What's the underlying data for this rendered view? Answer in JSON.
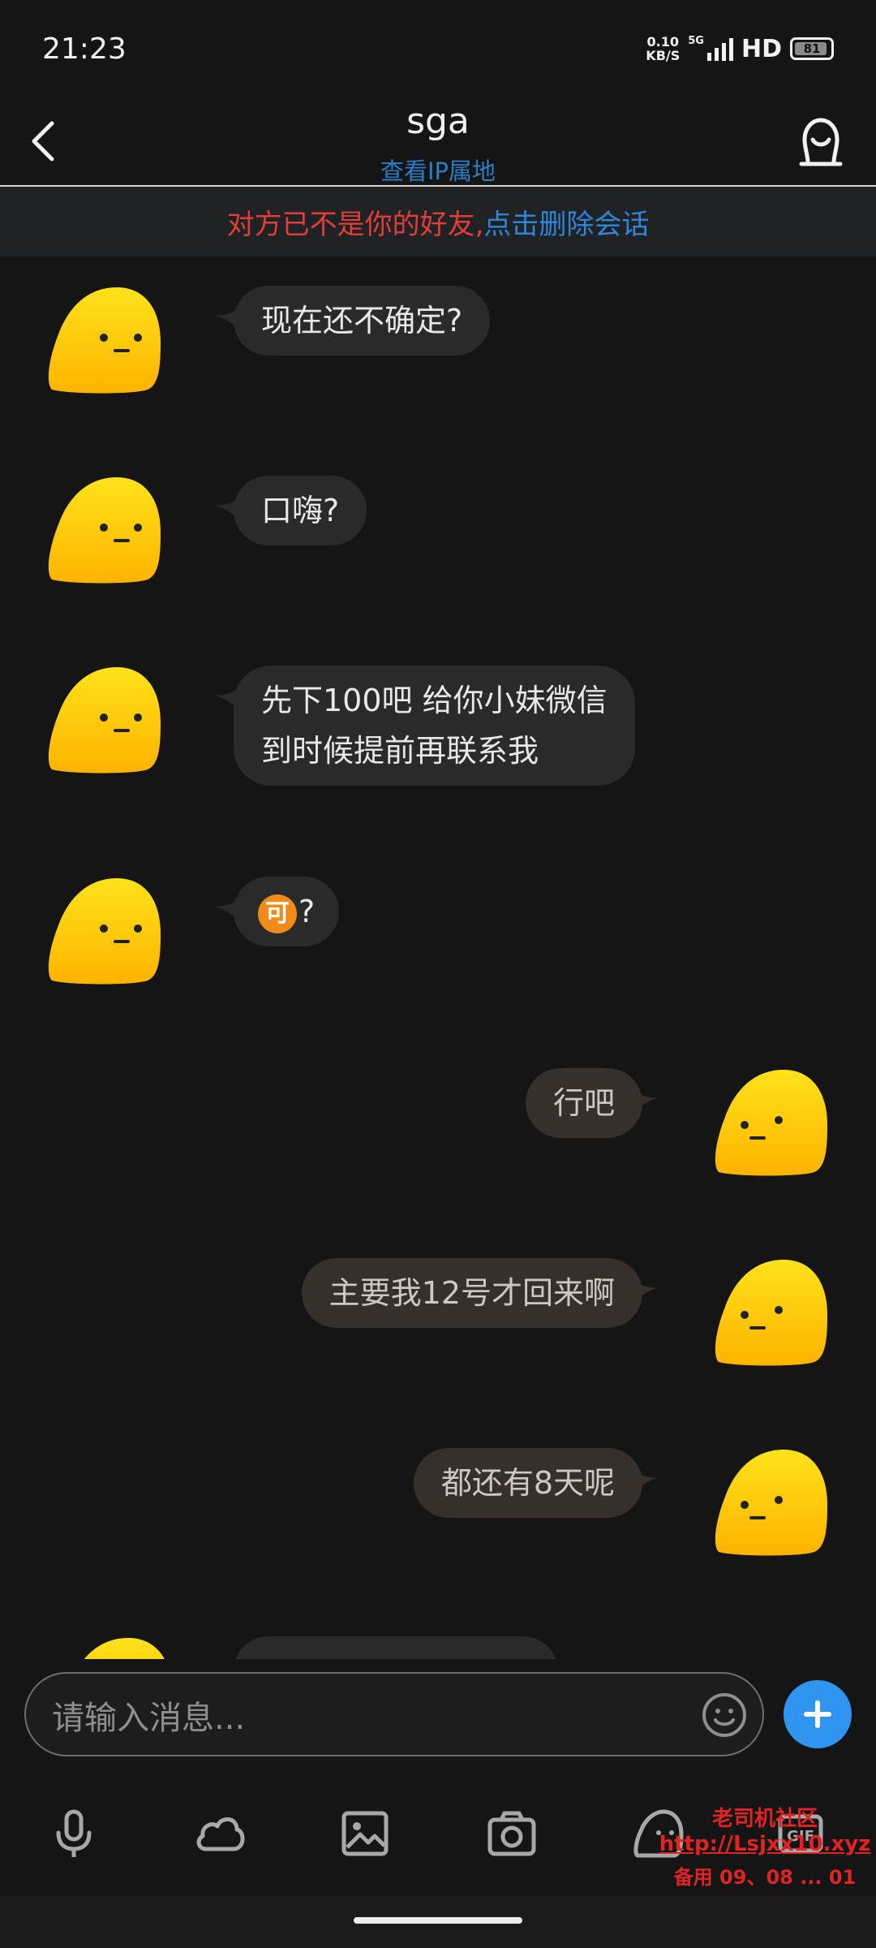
{
  "status_bar": {
    "time": "21:23",
    "net_speed_value": "0.10",
    "net_speed_unit": "KB/S",
    "network_type": "5G",
    "hd_label": "HD",
    "battery_level": "81"
  },
  "header": {
    "title": "sga",
    "subtitle": "查看IP属地",
    "back_icon": "chevron-left-icon",
    "profile_icon": "ghost-profile-icon"
  },
  "notice": {
    "warning_text": "对方已不是你的好友,",
    "action_text": "点击删除会话",
    "warning_color": "#e23d36",
    "action_color": "#2f86d9"
  },
  "messages": [
    {
      "side": "left",
      "text": "现在还不确定?"
    },
    {
      "side": "left",
      "text": "口嗨?"
    },
    {
      "side": "left",
      "line1": "先下100吧 给你小妹微信",
      "line2": "到时候提前再联系我"
    },
    {
      "side": "left",
      "emoji": "可",
      "text": "?"
    },
    {
      "side": "right",
      "text": "行吧"
    },
    {
      "side": "right",
      "text": "主要我12号才回来啊"
    },
    {
      "side": "right",
      "text": "都还有8天呢"
    },
    {
      "side": "left",
      "text": "...",
      "partial": true
    }
  ],
  "input": {
    "placeholder": "请输入消息...",
    "emoji_icon": "smiley-icon",
    "plus_icon": "plus-icon",
    "accent_color": "#2f95f0"
  },
  "toolbar": {
    "items": [
      "microphone-icon",
      "cloud-icon",
      "image-icon",
      "camera-icon",
      "ghost-icon",
      "gif-icon"
    ]
  },
  "watermark": {
    "line1": "老司机社区",
    "line2": "http://Lsjxx10.xyz",
    "line3": "备用 09、08 ... 01"
  }
}
